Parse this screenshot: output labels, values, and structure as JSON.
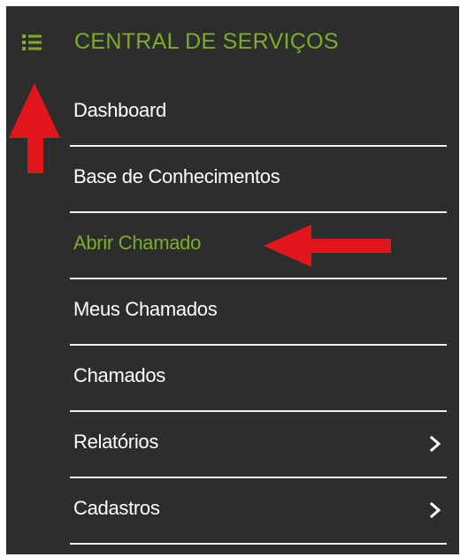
{
  "sidebar": {
    "title": "CENTRAL DE SERVIÇOS",
    "toggle_icon": "list-menu-icon",
    "items": [
      {
        "label": "Dashboard",
        "active": false,
        "has_submenu": false
      },
      {
        "label": "Base de Conhecimentos",
        "active": false,
        "has_submenu": false
      },
      {
        "label": "Abrir Chamado",
        "active": true,
        "has_submenu": false
      },
      {
        "label": "Meus Chamados",
        "active": false,
        "has_submenu": false
      },
      {
        "label": "Chamados",
        "active": false,
        "has_submenu": false
      },
      {
        "label": "Relatórios",
        "active": false,
        "has_submenu": true
      },
      {
        "label": "Cadastros",
        "active": false,
        "has_submenu": true
      }
    ]
  },
  "colors": {
    "sidebar_bg": "#2d2d2d",
    "accent": "#7bad27",
    "text": "#ffffff",
    "divider": "#f0f0f0",
    "annotation_arrow": "#e0161c"
  }
}
